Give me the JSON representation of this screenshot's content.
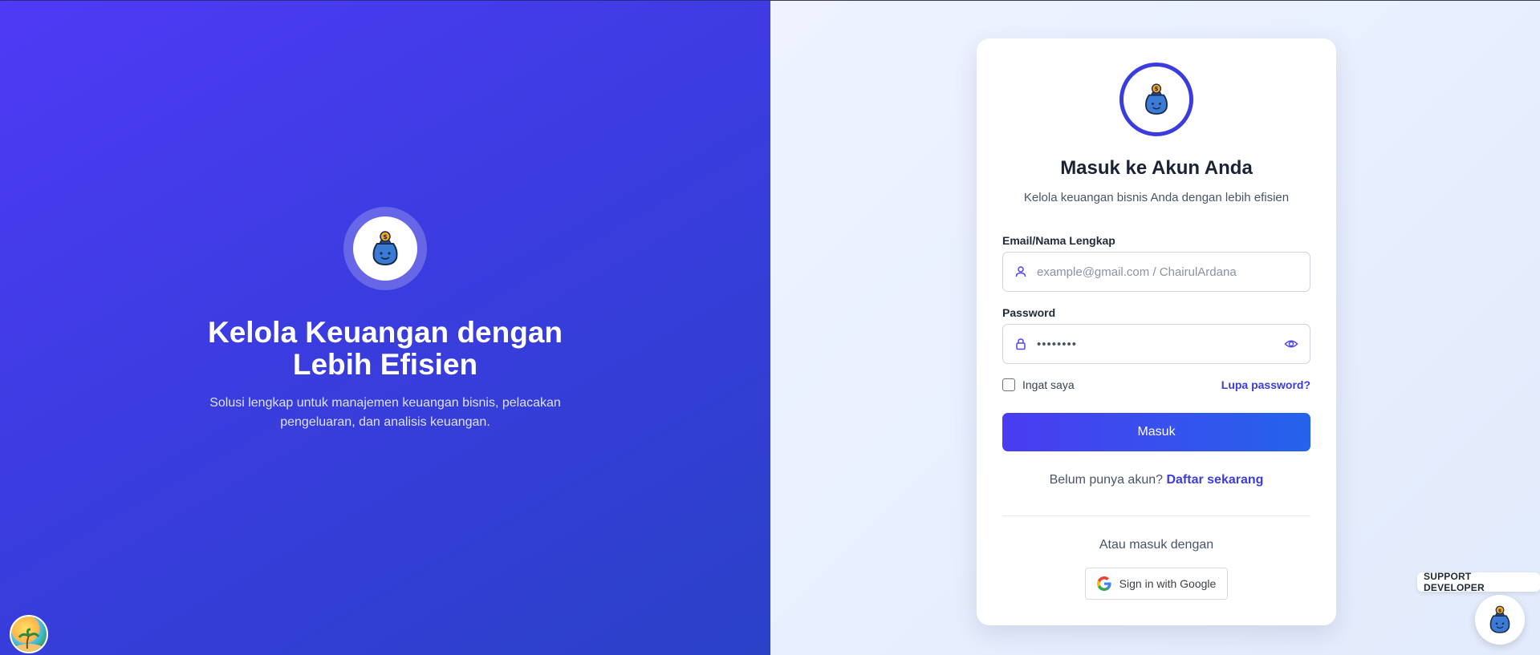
{
  "hero": {
    "title": "Kelola Keuangan dengan Lebih Efisien",
    "subtitle": "Solusi lengkap untuk manajemen keuangan bisnis, pelacakan pengeluaran, dan analisis keuangan.",
    "logo_icon": "money-bag-mascot-icon"
  },
  "login": {
    "title": "Masuk ke Akun Anda",
    "subtitle": "Kelola keuangan bisnis Anda dengan lebih efisien",
    "email_label": "Email/Nama Lengkap",
    "email_placeholder": "example@gmail.com / ChairulArdana",
    "password_label": "Password",
    "password_mask": "••••••••",
    "remember_label": "Ingat saya",
    "forgot_label": "Lupa password?",
    "submit_label": "Masuk",
    "register_prompt": "Belum punya akun?",
    "register_link": "Daftar sekarang",
    "alt_text": "Atau masuk dengan",
    "google_label": "Sign in with Google"
  },
  "support": {
    "label": "SUPPORT DEVELOPER"
  },
  "colors": {
    "accent": "#3b3ce0",
    "hero_gradient_start": "#4f3af6",
    "hero_gradient_end": "#2a41c8",
    "button_gradient_end": "#2563eb"
  }
}
